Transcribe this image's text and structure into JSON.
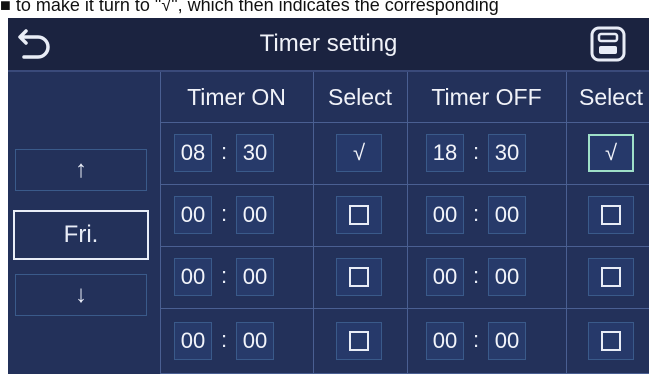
{
  "caption": "■ to make it turn to \"√\", which then indicates the corresponding",
  "header": {
    "title": "Timer setting"
  },
  "left": {
    "up_arrow": "↑",
    "day": "Fri.",
    "down_arrow": "↓"
  },
  "columns": {
    "timer_on": "Timer ON",
    "select_on": "Select",
    "timer_off": "Timer OFF",
    "select_off": "Select"
  },
  "check_mark": "√",
  "colon": ":",
  "rows": [
    {
      "on_h": "08",
      "on_m": "30",
      "on_sel": "√",
      "off_h": "18",
      "off_m": "30",
      "off_sel": "√"
    },
    {
      "on_h": "00",
      "on_m": "00",
      "on_sel": "",
      "off_h": "00",
      "off_m": "00",
      "off_sel": ""
    },
    {
      "on_h": "00",
      "on_m": "00",
      "on_sel": "",
      "off_h": "00",
      "off_m": "00",
      "off_sel": ""
    },
    {
      "on_h": "00",
      "on_m": "00",
      "on_sel": "",
      "off_h": "00",
      "off_m": "00",
      "off_sel": ""
    }
  ],
  "colors": {
    "screen_bg": "#23315a",
    "topbar_bg": "#1b2340",
    "grid_line": "#4a5f92",
    "active_select": "#9fe0c8"
  },
  "icons": {
    "back": "back-arrow-icon",
    "save": "save-icon"
  }
}
